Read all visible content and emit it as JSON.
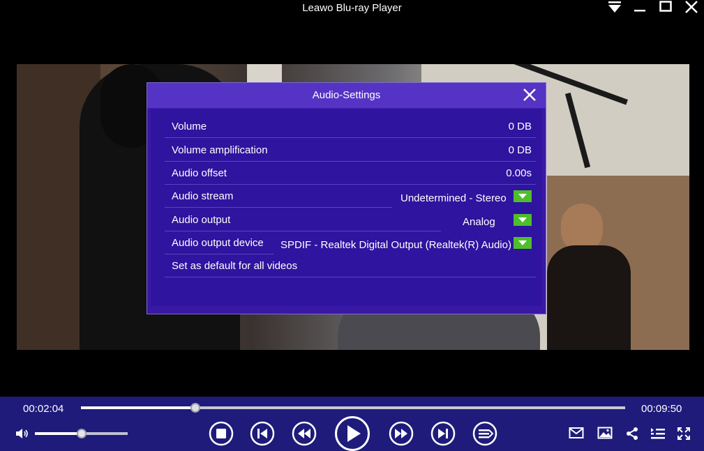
{
  "app": {
    "title": "Leawo Blu-ray Player"
  },
  "dialog": {
    "title": "Audio-Settings",
    "rows": [
      {
        "label": "Volume",
        "value": "0 DB"
      },
      {
        "label": "Volume amplification",
        "value": "0 DB"
      },
      {
        "label": "Audio offset",
        "value": "0.00s"
      },
      {
        "label": "Audio stream",
        "value": "Undetermined - Stereo"
      },
      {
        "label": "Audio output",
        "value": "Analog"
      },
      {
        "label": "Audio output device",
        "value": "SPDIF - Realtek Digital Output (Realtek(R) Audio)"
      },
      {
        "label": "Set as default for all videos"
      }
    ]
  },
  "player": {
    "current_time": "00:02:04",
    "total_time": "00:09:50",
    "progress_fraction": 0.2102,
    "volume_fraction": 0.5
  },
  "icons": [
    "menu-icon",
    "minimize-icon",
    "maximize-icon",
    "close-icon",
    "speaker-icon",
    "stop-icon",
    "previous-icon",
    "rewind-icon",
    "play-icon",
    "fast-forward-icon",
    "next-icon",
    "playlist-icon",
    "mail-icon",
    "snapshot-icon",
    "share-icon",
    "chapter-list-icon",
    "fullscreen-icon"
  ],
  "colors": {
    "dialog_bg": "#3a18a6",
    "dialog_header": "#5533c4",
    "dropdown_button": "#4fbe2c",
    "control_bar": "#1e1b7a"
  }
}
